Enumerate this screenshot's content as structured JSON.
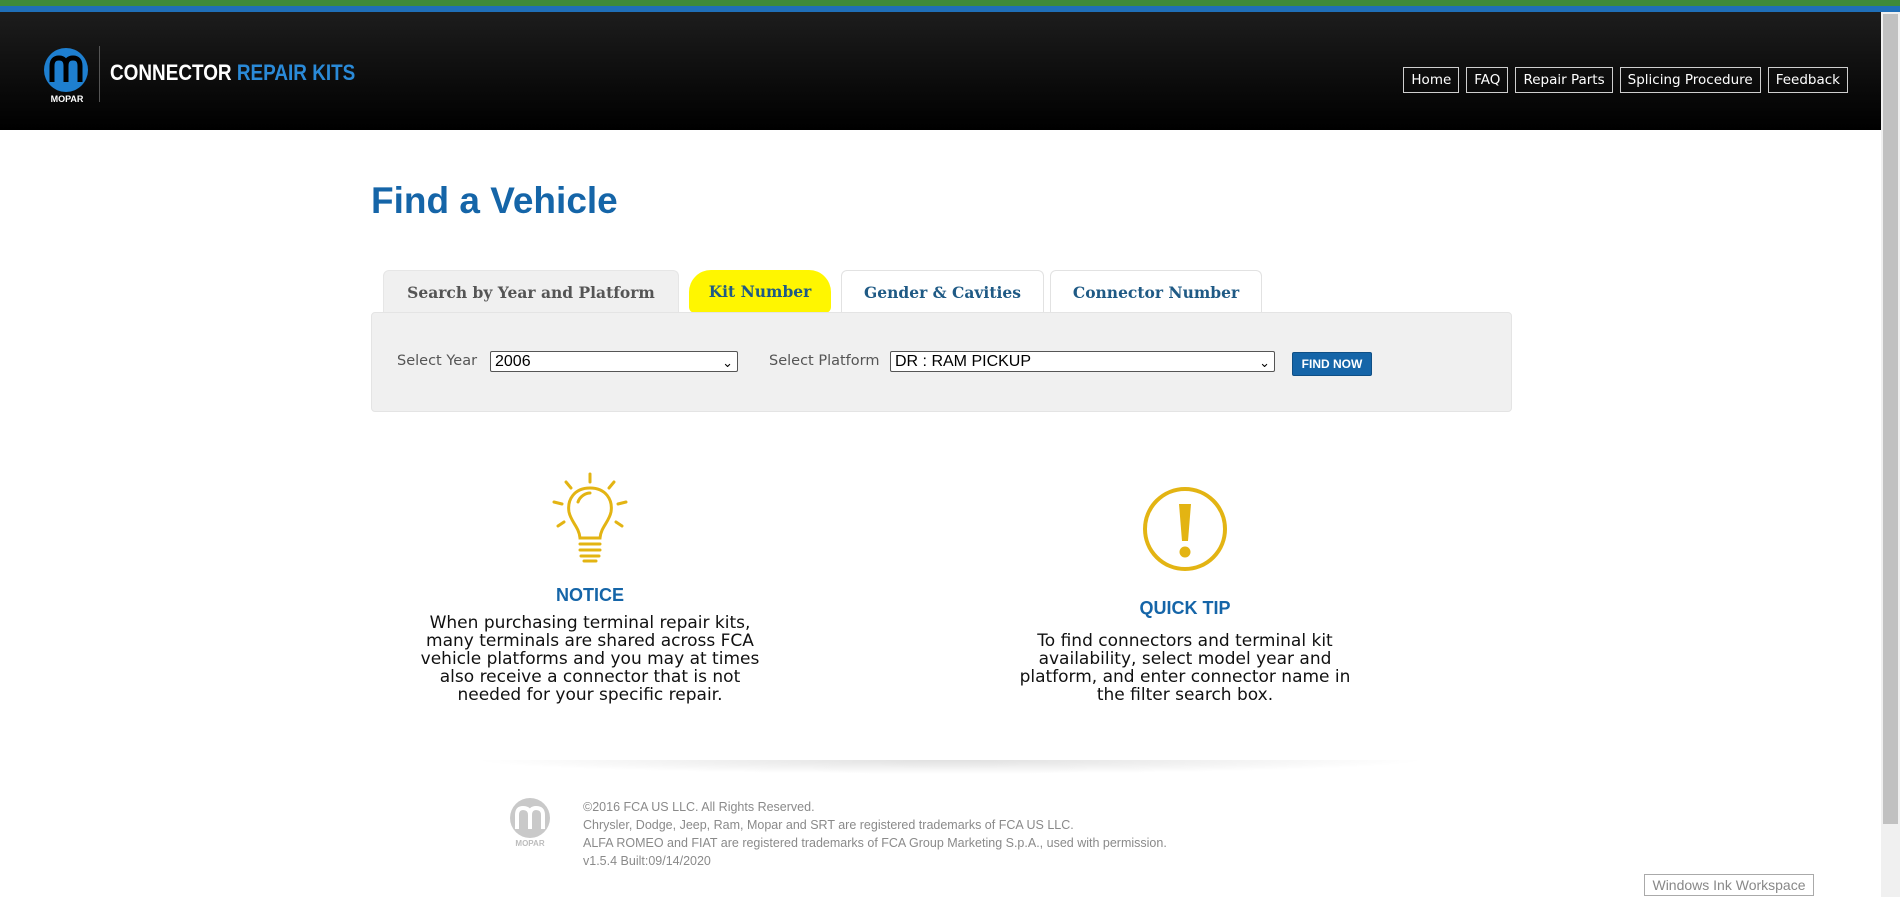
{
  "header": {
    "brand_word1": "CONNECTOR",
    "brand_word2": "REPAIR KITS",
    "logo_text": "MOPAR",
    "nav": [
      "Home",
      "FAQ",
      "Repair Parts",
      "Splicing Procedure",
      "Feedback"
    ]
  },
  "main": {
    "title": "Find a Vehicle",
    "tabs": [
      {
        "label": "Search by Year and Platform",
        "state": "active"
      },
      {
        "label": "Kit Number",
        "state": "highlighted"
      },
      {
        "label": "Gender & Cavities",
        "state": "normal"
      },
      {
        "label": "Connector Number",
        "state": "normal"
      }
    ],
    "search": {
      "year_label": "Select Year",
      "year_value": "2006",
      "platform_label": "Select Platform",
      "platform_value": "DR : RAM PICKUP",
      "find_button": "FIND NOW"
    }
  },
  "notice": {
    "icon": "lightbulb-icon",
    "title": "NOTICE",
    "lines": [
      "When purchasing terminal repair kits,",
      "many terminals are shared across FCA",
      "vehicle platforms and you may at times",
      "also receive a connector that is not",
      "needed for your specific repair."
    ]
  },
  "quick_tip": {
    "icon": "exclamation-circle-icon",
    "title": "QUICK TIP",
    "lines": [
      "To find connectors and terminal kit",
      "availability, select model year and",
      "platform, and enter connector name in",
      "the filter search box."
    ]
  },
  "footer": {
    "logo_text": "MOPAR",
    "lines": [
      "©2016 FCA US LLC. All Rights Reserved.",
      "Chrysler, Dodge, Jeep, Ram, Mopar and SRT are registered trademarks of FCA US LLC.",
      "ALFA ROMEO and FIAT are registered trademarks of FCA Group Marketing S.p.A., used with permission.",
      "v1.5.4 Built:09/14/2020"
    ]
  },
  "overlay": {
    "ink_workspace": "Windows Ink Workspace"
  },
  "colors": {
    "accent_blue": "#1565a8",
    "brand_blue": "#2a8ad8",
    "highlight_yellow": "#fff600",
    "icon_gold": "#e3b413"
  }
}
